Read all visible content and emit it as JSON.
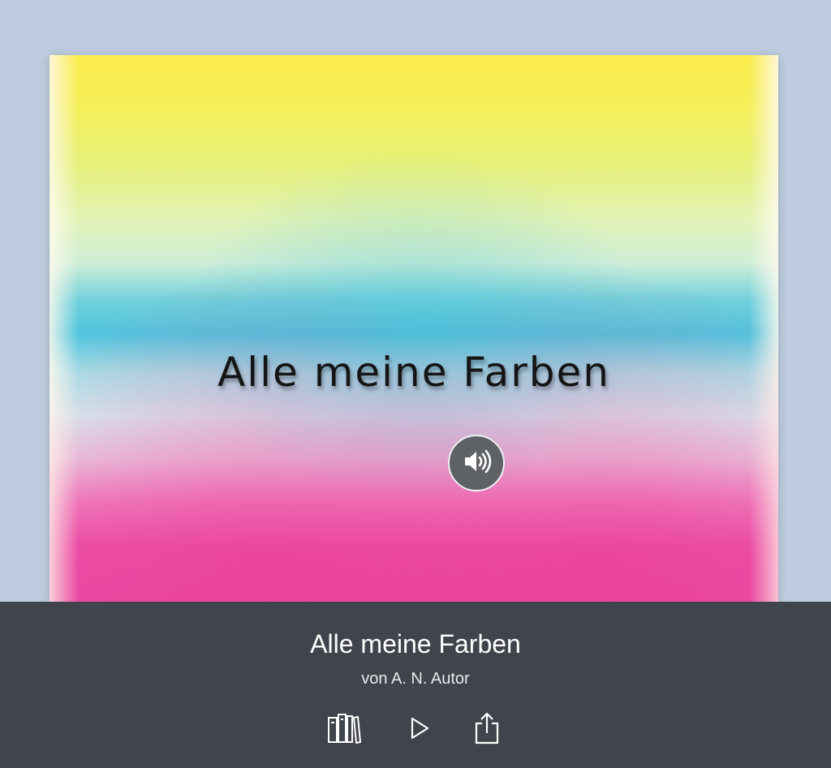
{
  "cover": {
    "title": "Alle meine Farben",
    "audio_icon": "speaker-icon"
  },
  "bottom_bar": {
    "title": "Alle meine Farben",
    "author": "von A. N. Autor",
    "actions": [
      {
        "icon": "library-icon"
      },
      {
        "icon": "play-icon"
      },
      {
        "icon": "share-icon"
      }
    ]
  },
  "colors": {
    "background": "#bccbdd",
    "bar": "#40444c",
    "audio_button": "#5e6266"
  }
}
